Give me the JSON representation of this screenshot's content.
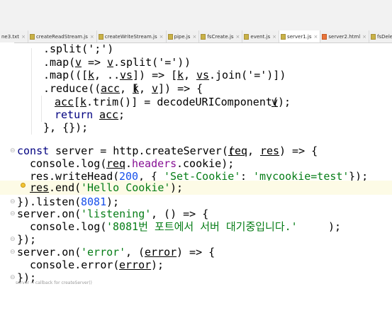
{
  "tabs": [
    {
      "label": "ne3.txt",
      "type": "txt"
    },
    {
      "label": "createReadStream.js",
      "type": "js"
    },
    {
      "label": "createWriteStream.js",
      "type": "js"
    },
    {
      "label": "pipe.js",
      "type": "js"
    },
    {
      "label": "fsCreate.js",
      "type": "js"
    },
    {
      "label": "event.js",
      "type": "js"
    },
    {
      "label": "server1.js",
      "type": "js",
      "active": true
    },
    {
      "label": "server2.html",
      "type": "html"
    },
    {
      "label": "fsDelete.js",
      "type": "js"
    }
  ],
  "close_glyph": "×",
  "code": {
    "l1": ".split(';')",
    "l2_a": ".map(",
    "l2_b": "v",
    "l2_c": " => ",
    "l2_d": "v",
    "l2_e": ".split('=')",
    "l2_f": ")",
    "l3_a": ".map(([",
    "l3_b": "k",
    "l3_c": ", ...",
    "l3_d": "vs",
    "l3_e": "]) => [",
    "l3_f": "k",
    "l3_g": ", ",
    "l3_h": "vs",
    "l3_i": ".join('=')])",
    "l4_a": ".reduce((",
    "l4_b": "acc",
    "l4_c": ", [",
    "l4_d": "k",
    "l4_e": ", ",
    "l4_f": "v",
    "l4_g": "]) => {",
    "l5_a": "acc",
    "l5_b": "[",
    "l5_c": "k",
    "l5_d": ".trim()] = decodeURIComponent(",
    "l5_e": "v",
    "l5_f": ");",
    "l6_a": "return ",
    "l6_b": "acc",
    "l6_c": ";",
    "l7": "}, {});",
    "l9_a": "const",
    "l9_b": " server = http.createServer((",
    "l9_c": "req",
    "l9_d": ", ",
    "l9_e": "res",
    "l9_f": ") => {",
    "l10_a": "console.log(",
    "l10_b": "req",
    "l10_c": ".",
    "l10_d": "headers",
    "l10_e": ".cookie);",
    "l11_a": "res",
    "l11_b": ".writeHead(",
    "l11_c": "200",
    "l11_d": ", { ",
    "l11_e": "'Set-Cookie'",
    "l11_f": ": ",
    "l11_g": "'mycookie=test'",
    "l11_h": " });",
    "l12_a": "res",
    "l12_b": ".end(",
    "l12_c": "'Hello Cookie'",
    "l12_d": ");",
    "l13_a": "}).listen(",
    "l13_b": "8081",
    "l13_c": ");",
    "l14_a": "server.on(",
    "l14_b": "'listening'",
    "l14_c": ", () => {",
    "l15_a": "console.log(",
    "l15_b": "'8081번 포트에서 서버 대기중입니다.'",
    "l15_c": ");",
    "l16": "});",
    "l17_a": "server.on(",
    "l17_b": "'error'",
    "l17_c": ", (",
    "l17_d": "error",
    "l17_e": ") => {",
    "l18_a": "console.error(",
    "l18_b": "error",
    "l18_c": ");",
    "l19": "});"
  },
  "hint_text": "server → callback for createServer()",
  "colors": {
    "keyword": "#000080",
    "string": "#067d17",
    "number": "#1750eb",
    "property": "#871094"
  }
}
